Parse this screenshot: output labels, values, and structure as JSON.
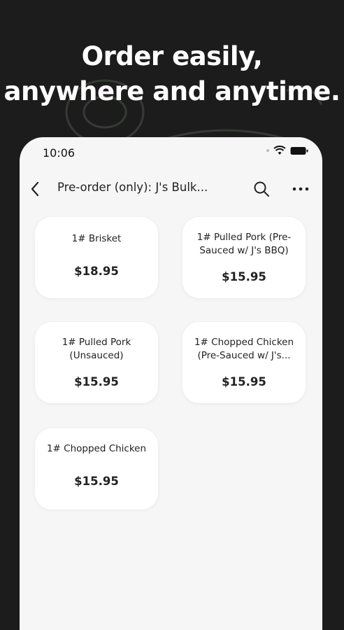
{
  "promo": {
    "headline_line1": "Order easily,",
    "headline_line2": "anywhere and anytime."
  },
  "status_bar": {
    "time": "10:06",
    "icons": [
      "wifi-icon",
      "battery-icon"
    ]
  },
  "nav": {
    "title": "Pre-order (only): J's Bulk...",
    "back_icon": "chevron-left-icon",
    "search_icon": "search-icon",
    "more_icon": "more-horizontal-icon"
  },
  "products": [
    {
      "name": "1# Brisket",
      "price": "$18.95"
    },
    {
      "name": "1# Pulled Pork (Pre-\nSauced w/ J's BBQ)",
      "price": "$15.95"
    },
    {
      "name": "1# Pulled Pork\n(Unsauced)",
      "price": "$15.95"
    },
    {
      "name": "1# Chopped Chicken\n(Pre-Sauced w/ J's...",
      "price": "$15.95"
    },
    {
      "name": "1# Chopped Chicken",
      "price": "$15.95"
    }
  ],
  "colors": {
    "background": "#1c1c1c",
    "screen": "#f6f6f6",
    "card": "#ffffff",
    "text": "#222222"
  }
}
